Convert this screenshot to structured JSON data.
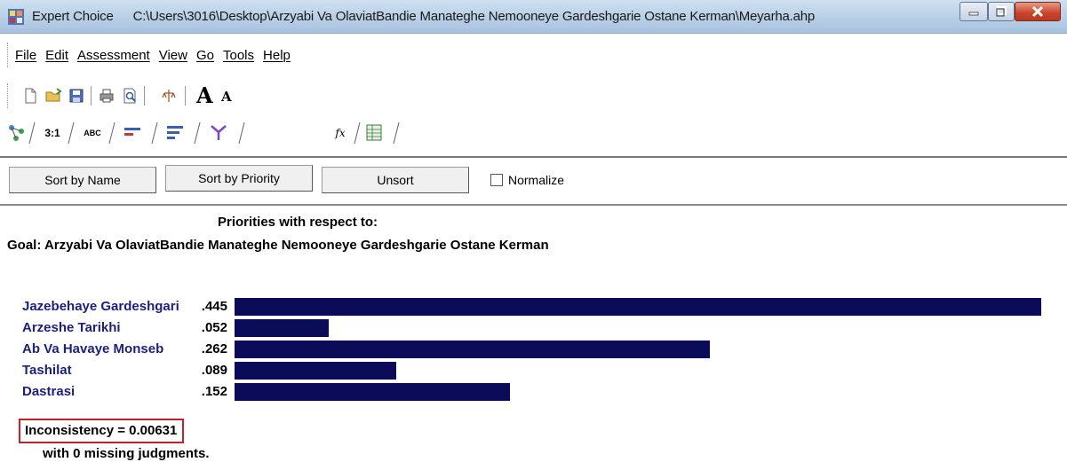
{
  "window": {
    "app_name": "Expert Choice",
    "file_path": "C:\\Users\\3016\\Desktop\\Arzyabi Va OlaviatBandie Manateghe Nemooneye Gardeshgarie Ostane Kerman\\Meyarha.ahp",
    "controls": [
      "minimize-icon",
      "maximize-icon",
      "close-icon"
    ]
  },
  "menu": {
    "items": [
      "File",
      "Edit",
      "Assessment",
      "View",
      "Go",
      "Tools",
      "Help"
    ]
  },
  "toolbar": {
    "icons": [
      "new-file-icon",
      "open-folder-icon",
      "save-icon",
      "print-icon",
      "print-preview-icon",
      "model-icon"
    ],
    "font_larger": "A",
    "font_smaller": "A"
  },
  "tabs": {
    "pairwise_label": "3:1",
    "verbal_label": "ABC",
    "icons": [
      "hierarchy-tab-icon",
      "numerical-tab-icon",
      "verbal-tab-icon",
      "graphical-tab-icon",
      "priorities-tab-icon",
      "synthesis-tab-icon",
      "formula-tab-icon",
      "data-grid-tab-icon"
    ],
    "formula_label": "fx"
  },
  "controls": {
    "sort_by_name": "Sort by Name",
    "sort_by_priority": "Sort by Priority",
    "unsort": "Unsort",
    "normalize": "Normalize",
    "normalize_checked": false
  },
  "report": {
    "heading": "Priorities with respect to:",
    "goal": "Goal: Arzyabi Va OlaviatBandie Manateghe Nemooneye Gardeshgarie Ostane Kerman",
    "bar_color": "#0b0b5a",
    "label_color": "#1d1f7c",
    "highlight_color": "#c8202b",
    "inconsistency": "Inconsistency = 0.00631",
    "missing": "with 0  missing judgments."
  },
  "chart_data": {
    "type": "bar",
    "orientation": "horizontal",
    "categories": [
      "Jazebehaye Gardeshgari",
      "Arzeshe Tarikhi",
      "Ab Va Havaye Monseb",
      "Tashilat",
      "Dastrasi"
    ],
    "value_labels": [
      ".445",
      ".052",
      ".262",
      ".089",
      ".152"
    ],
    "values": [
      0.445,
      0.052,
      0.262,
      0.089,
      0.152
    ]
  }
}
